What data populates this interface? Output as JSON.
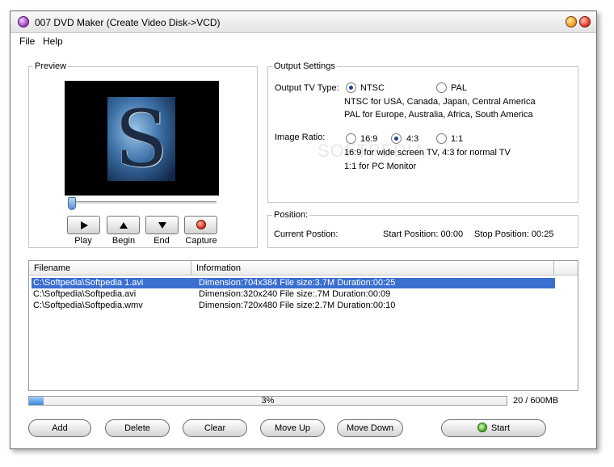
{
  "window": {
    "title": "007 DVD Maker (Create Video Disk->VCD)"
  },
  "menu": {
    "items": [
      "File",
      "Help"
    ]
  },
  "preview": {
    "legend": "Preview",
    "slider_value_percent": 2,
    "controls": [
      {
        "label": "Play",
        "icon": "play-icon"
      },
      {
        "label": "Begin",
        "icon": "triangle-up-icon"
      },
      {
        "label": "End",
        "icon": "triangle-down-icon"
      },
      {
        "label": "Capture",
        "icon": "record-icon"
      }
    ]
  },
  "output_settings": {
    "legend": "Output Settings",
    "tv_type_label": "Output TV Type:",
    "tv_options": [
      "NTSC",
      "PAL"
    ],
    "tv_selected": "NTSC",
    "ntsc_note": "NTSC for USA, Canada, Japan, Central  America",
    "pal_note": "PAL for Europe, Australia, Africa, South America",
    "ratio_label": "Image Ratio:",
    "ratio_options": [
      "16:9",
      "4:3",
      "1:1"
    ],
    "ratio_selected": "4:3",
    "ratio_note_1": "16:9 for wide screen TV,  4:3 for normal TV",
    "ratio_note_2": "1:1 for PC Monitor",
    "watermark": "SOFTPEDIA"
  },
  "position": {
    "legend": "Position:",
    "current": "Current Postion:",
    "start": "Start Position: 00:00",
    "stop": "Stop Position: 00:25"
  },
  "list": {
    "columns": [
      "Filename",
      "Information"
    ],
    "rows": [
      {
        "filename": "C:\\Softpedia\\Softpedia 1.avi",
        "info": "Dimension:704x384 File size:3.7M Duration:00:25",
        "selected": true
      },
      {
        "filename": "C:\\Softpedia\\Softpedia.avi",
        "info": "Dimension:320x240 File size:.7M Duration:00:09",
        "selected": false
      },
      {
        "filename": "C:\\Softpedia\\Softpedia.wmv",
        "info": "Dimension:720x480 File size:2.7M Duration:00:10",
        "selected": false
      }
    ]
  },
  "progress": {
    "percent": 3,
    "label": "3%",
    "size": "20 / 600MB"
  },
  "buttons": {
    "add": "Add",
    "delete": "Delete",
    "clear": "Clear",
    "move_up": "Move Up",
    "move_down": "Move Down",
    "start": "Start"
  },
  "colors": {
    "selection": "#3a6fd0",
    "progress": "#3a86d9"
  }
}
